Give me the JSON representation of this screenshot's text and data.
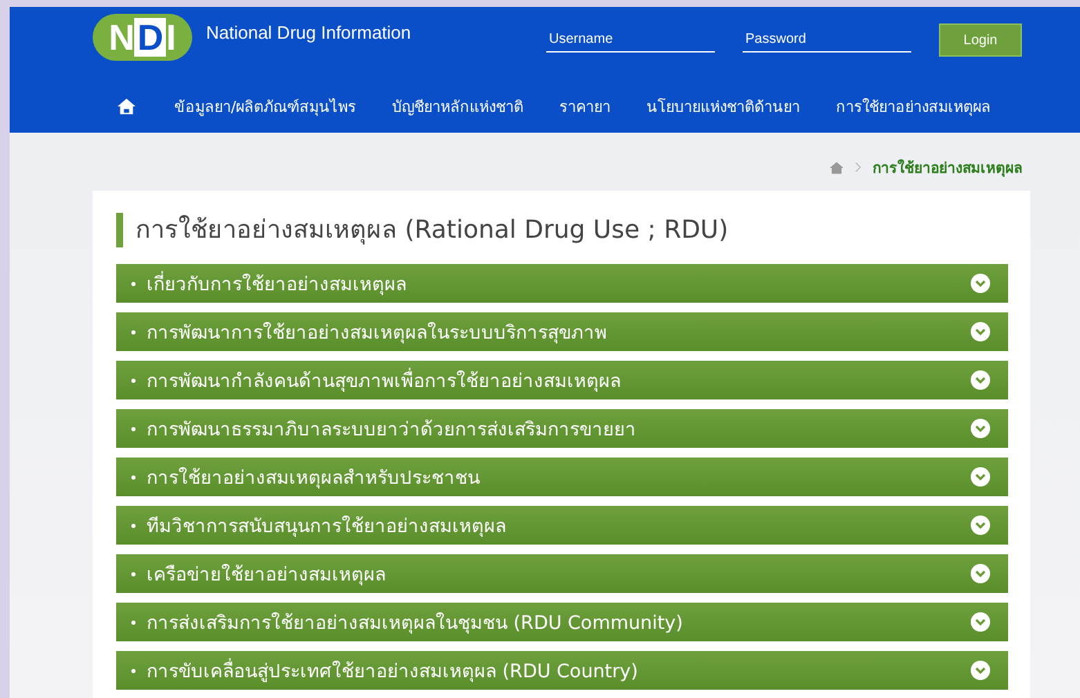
{
  "header": {
    "logo": {
      "letters": "NDI"
    },
    "site_title": "National Drug Information",
    "username": {
      "placeholder": "Username"
    },
    "password": {
      "placeholder": "Password"
    },
    "login_button": "Login"
  },
  "nav": {
    "items": [
      "ข้อมูลยา/ผลิตภัณฑ์สมุนไพร",
      "บัญชียาหลักแห่งชาติ",
      "ราคายา",
      "นโยบายแห่งชาติด้านยา",
      "การใช้ยาอย่างสมเหตุผล"
    ]
  },
  "breadcrumb": {
    "current": "การใช้ยาอย่างสมเหตุผล"
  },
  "page_title": "การใช้ยาอย่างสมเหตุผล (Rational Drug Use ; RDU)",
  "sections": [
    {
      "label": "เกี่ยวกับการใช้ยาอย่างสมเหตุผล",
      "expanded": false
    },
    {
      "label": "การพัฒนาการใช้ยาอย่างสมเหตุผลในระบบบริการสุขภาพ",
      "expanded": false
    },
    {
      "label": "การพัฒนากำลังคนด้านสุขภาพเพื่อการใช้ยาอย่างสมเหตุผล",
      "expanded": false
    },
    {
      "label": "การพัฒนาธรรมาภิบาลระบบยาว่าด้วยการส่งเสริมการขายยา",
      "expanded": false
    },
    {
      "label": "การใช้ยาอย่างสมเหตุผลสำหรับประชาชน",
      "expanded": false
    },
    {
      "label": "ทีมวิชาการสนับสนุนการใช้ยาอย่างสมเหตุผล",
      "expanded": false
    },
    {
      "label": "เครือข่ายใช้ยาอย่างสมเหตุผล",
      "expanded": false
    },
    {
      "label": "การส่งเสริมการใช้ยาอย่างสมเหตุผลในชุมชน (RDU Community)",
      "expanded": false
    },
    {
      "label": "การขับเคลื่อนสู่ประเทศใช้ยาอย่างสมเหตุผล (RDU Country)",
      "expanded": false
    }
  ]
}
